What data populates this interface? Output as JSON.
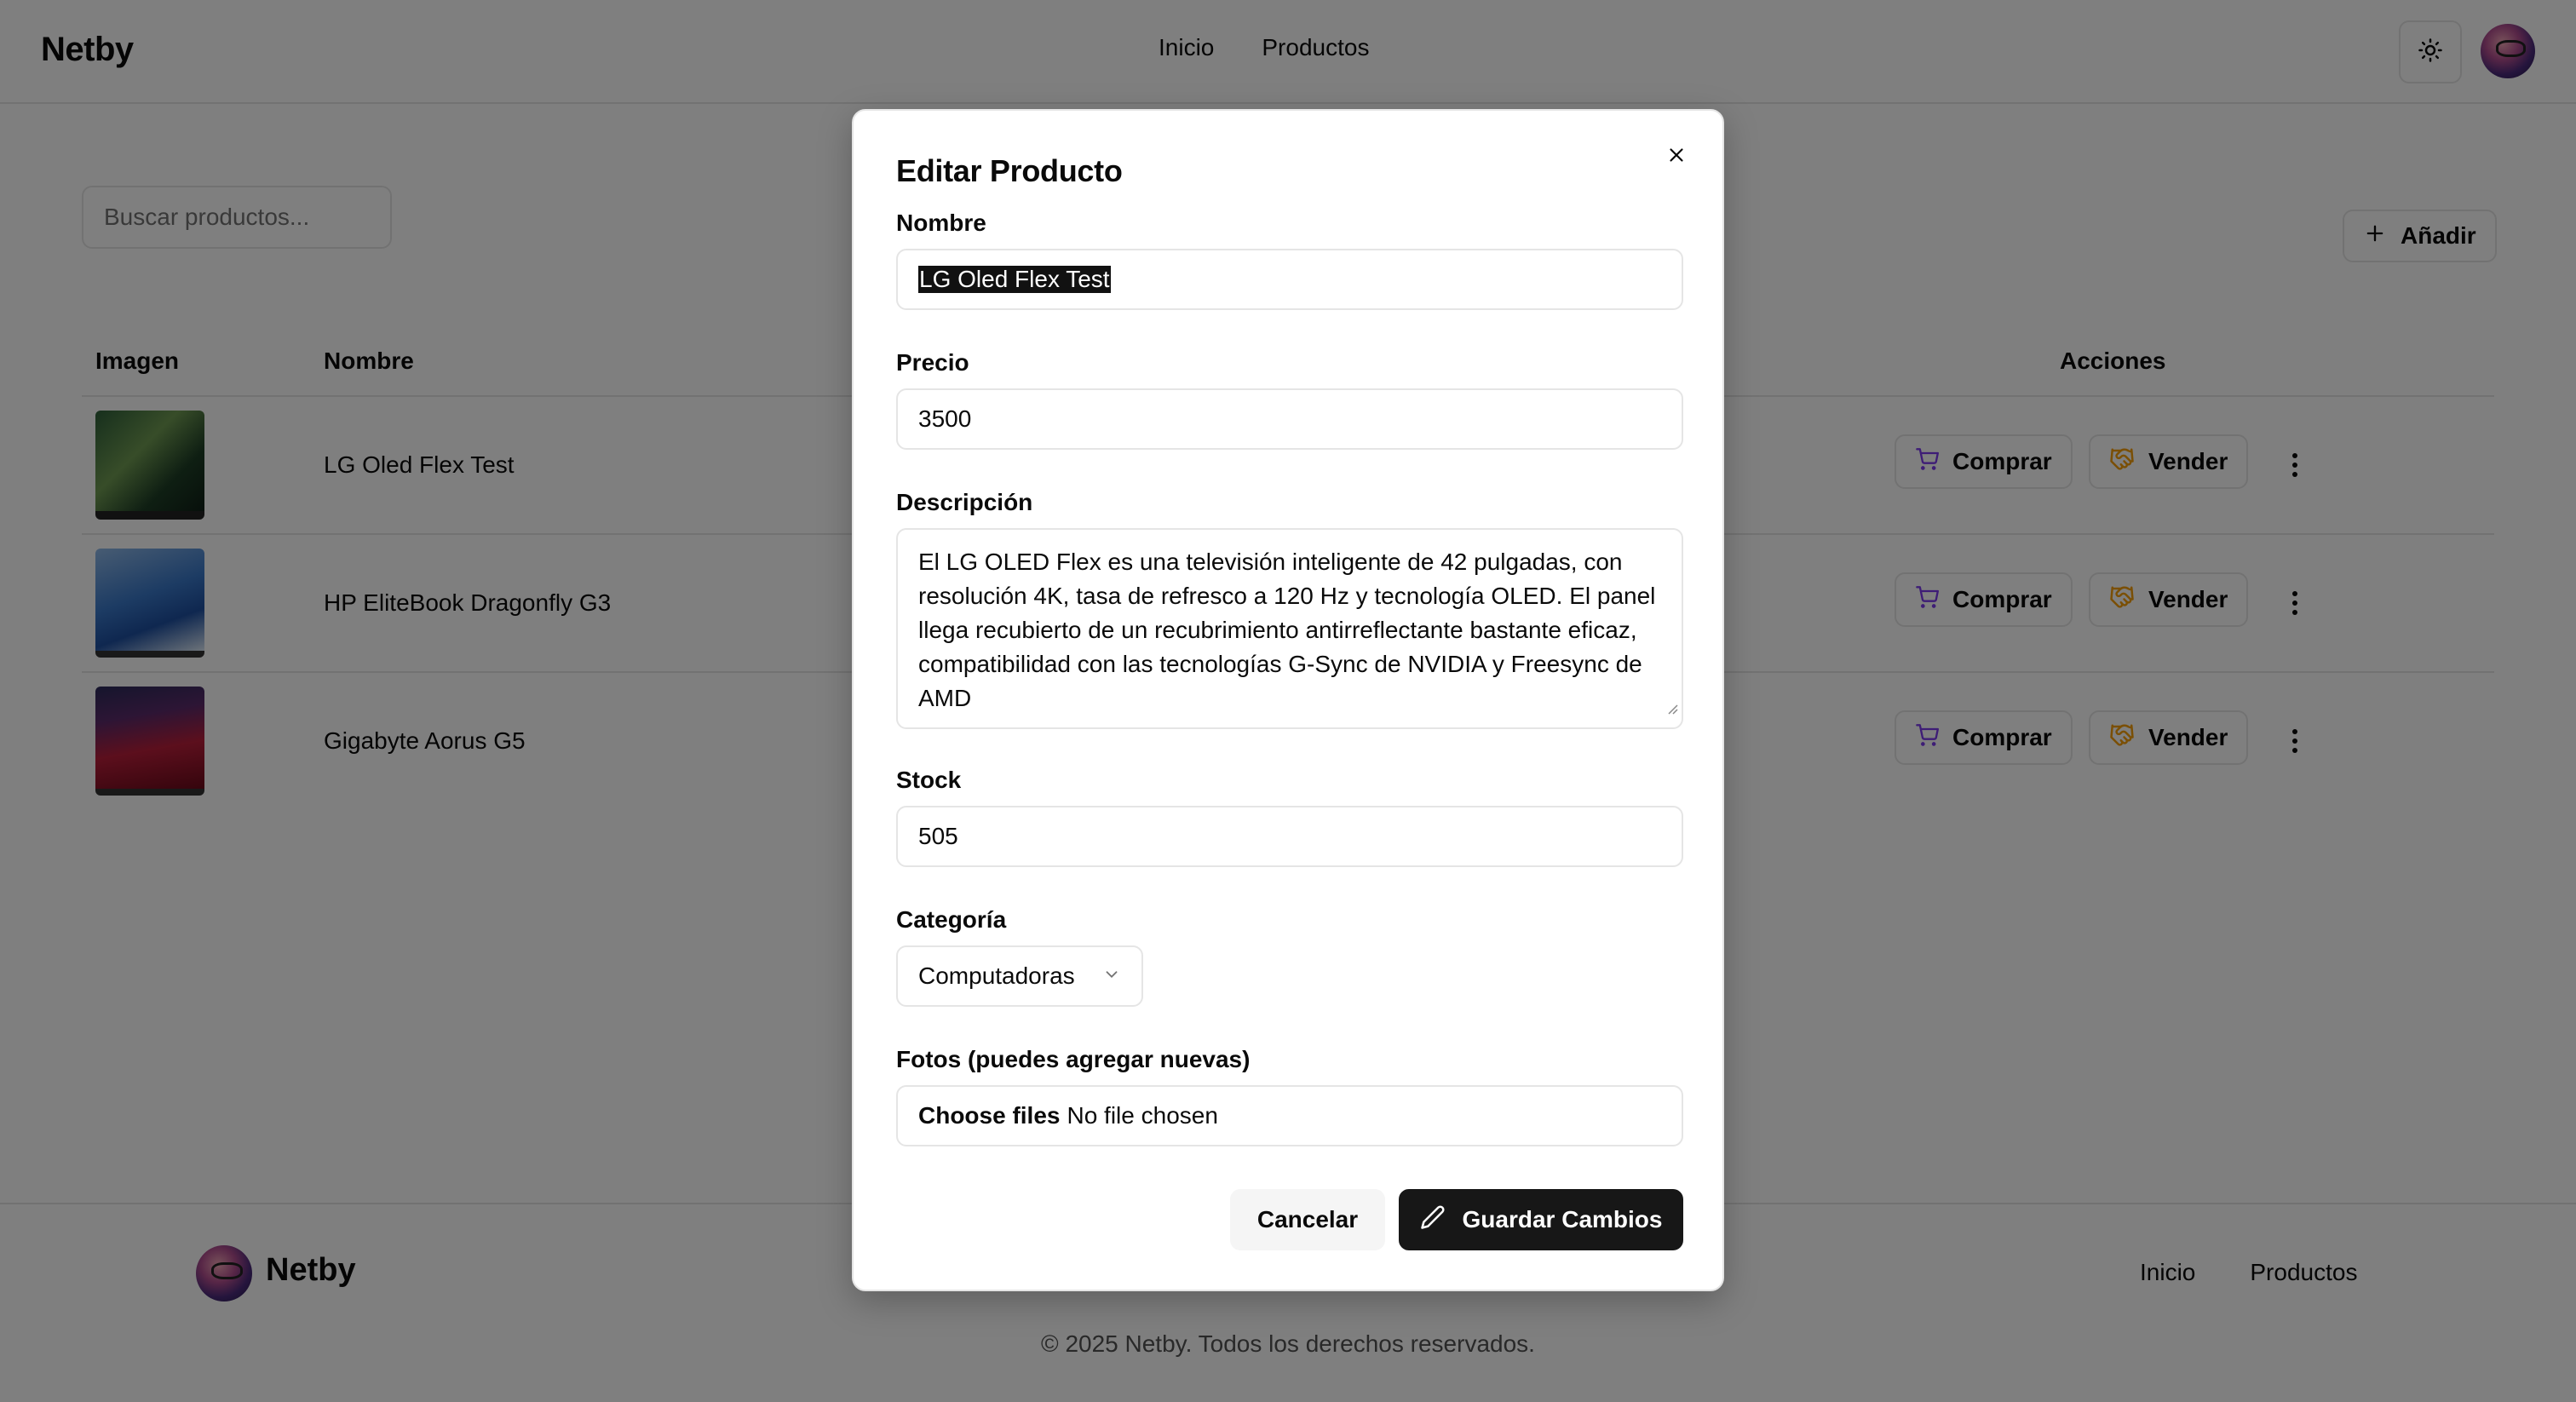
{
  "header": {
    "brand": "Netby",
    "nav": [
      "Inicio",
      "Productos"
    ],
    "theme_icon": "sun-icon"
  },
  "toolbar": {
    "search_placeholder": "Buscar productos...",
    "add_label": "Añadir"
  },
  "table": {
    "columns": {
      "image": "Imagen",
      "name": "Nombre",
      "actions": "Acciones"
    },
    "rows": [
      {
        "name": "LG Oled Flex Test"
      },
      {
        "name": "HP EliteBook Dragonfly G3"
      },
      {
        "name": "Gigabyte Aorus G5"
      }
    ],
    "buy_label": "Comprar",
    "sell_label": "Vender"
  },
  "footer": {
    "brand": "Netby",
    "nav": [
      "Inicio",
      "Productos"
    ],
    "copyright": "© 2025 Netby. Todos los derechos reservados."
  },
  "modal": {
    "title": "Editar Producto",
    "fields": {
      "name": {
        "label": "Nombre",
        "value": "LG Oled Flex Test"
      },
      "price": {
        "label": "Precio",
        "value": "3500"
      },
      "description": {
        "label": "Descripción",
        "value": "El LG OLED Flex es una televisión inteligente de 42 pulgadas, con resolución 4K, tasa de refresco a 120 Hz y tecnología OLED. El panel llega recubierto de un recubrimiento antirreflectante bastante eficaz, compatibilidad con las tecnologías G-Sync de NVIDIA y Freesync de AMD"
      },
      "stock": {
        "label": "Stock",
        "value": "505"
      },
      "category": {
        "label": "Categoría",
        "value": "Computadoras"
      },
      "photos": {
        "label": "Fotos (puedes agregar nuevas)",
        "button": "Choose files",
        "status": "No file chosen"
      }
    },
    "cancel_label": "Cancelar",
    "save_label": "Guardar Cambios"
  },
  "colors": {
    "accent_purple": "#7c3aed",
    "accent_orange": "#f59e0b",
    "primary_dark": "#171717",
    "overlay": "rgba(0,0,0,0.5)"
  }
}
